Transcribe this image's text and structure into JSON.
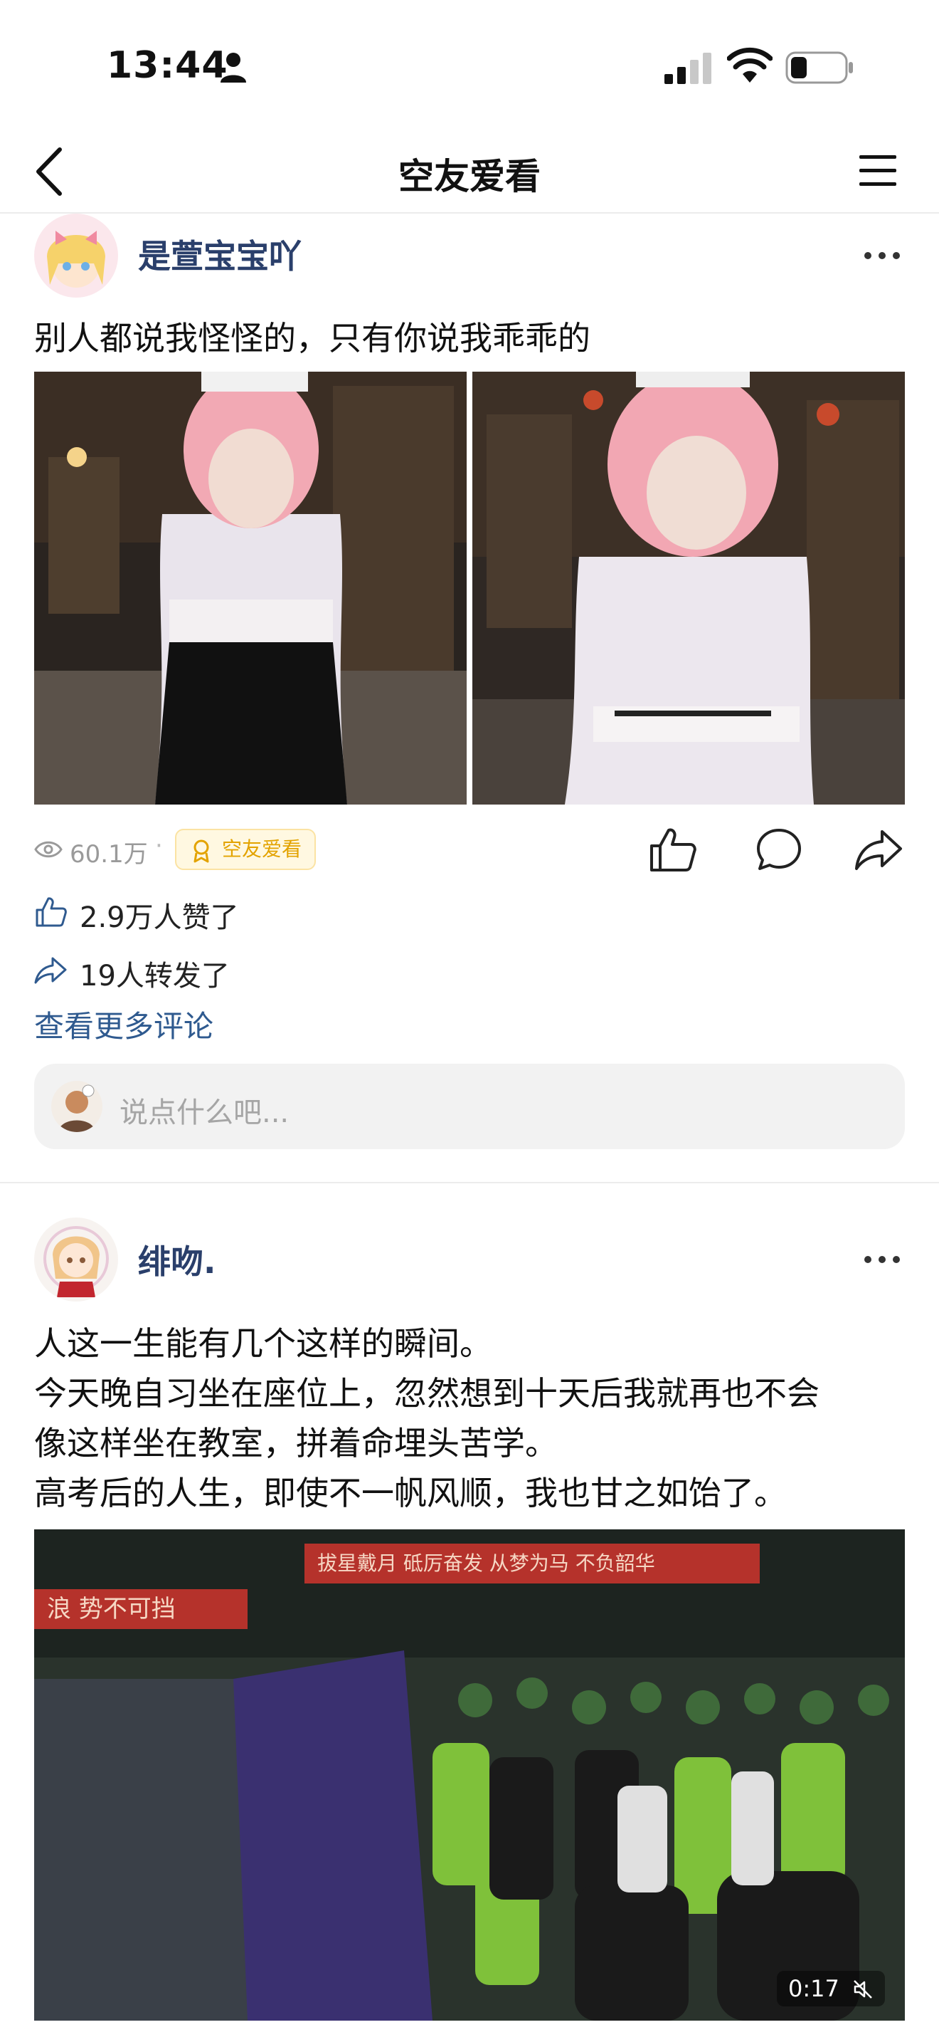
{
  "status_bar": {
    "time": "13:44"
  },
  "nav": {
    "title": "空友爱看"
  },
  "posts": [
    {
      "username": "是萱宝宝吖",
      "text": "别人都说我怪怪的，只有你说我乖乖的",
      "views": "60.1万",
      "separator": "·",
      "topic": "空友爱看",
      "likes": "2.9万人赞了",
      "shares": "19人转发了",
      "more_comments": "查看更多评论",
      "comment_placeholder": "说点什么吧..."
    },
    {
      "username": "绯吻.",
      "text_lines": [
        "人这一生能有几个这样的瞬间。",
        "今天晚自习坐在座位上，忽然想到十天后我就再也不会",
        "像这样坐在教室，拼着命埋头苦学。",
        "高考后的人生，即使不一帆风顺，我也甘之如饴了。"
      ],
      "video_duration": "0:17",
      "banner_left": "浪 势不可挡",
      "banner_right": "拔星戴月 砥厉奋发 从梦为马 不负韶华"
    }
  ],
  "colors": {
    "username": "#2a3f6b",
    "link": "#2f5a8f",
    "topic_badge_text": "#e3a300"
  }
}
